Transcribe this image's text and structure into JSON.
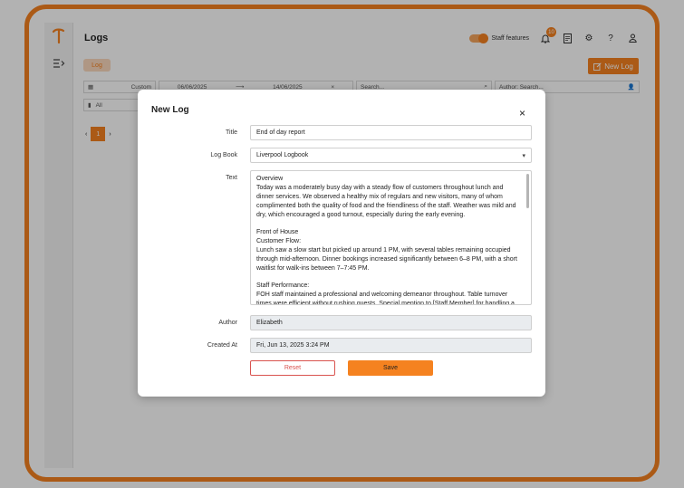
{
  "app": {
    "page_title": "Logs",
    "staff_features_label": "Staff features",
    "notification_count": "10",
    "log_tab_label": "Log",
    "new_log_label": "New Log",
    "accent_color": "#f58220"
  },
  "filters": {
    "range_preset": "Custom",
    "date_from": "06/06/2025",
    "date_to": "14/06/2025",
    "date_arrow": "⟶",
    "clear": "×",
    "search_placeholder": "Search...",
    "author_label": "Author:",
    "author_placeholder": "Search...",
    "logbook_filter": "All"
  },
  "pagination": {
    "prev": "‹",
    "current": "1",
    "next": "›"
  },
  "modal": {
    "title": "New Log",
    "close": "×",
    "fields": {
      "title_label": "Title",
      "title_value": "End of day report",
      "logbook_label": "Log Book",
      "logbook_value": "Liverpool Logbook",
      "text_label": "Text",
      "text_lines": [
        "Overview",
        "Today was a moderately busy day with a steady flow of customers throughout lunch and dinner services. We observed a healthy mix of regulars and new visitors, many of whom complimented both the quality of food and the friendliness of the staff. Weather was mild and dry, which encouraged a good turnout, especially during the early evening.",
        "",
        "Front of House",
        "Customer Flow:",
        "Lunch saw a slow start but picked up around 1 PM, with several tables remaining occupied through mid-afternoon. Dinner bookings increased significantly between 6–8 PM, with a short waitlist for walk-ins between 7–7:45 PM.",
        "",
        "Staff Performance:",
        "FOH staff maintained a professional and welcoming demeanor throughout. Table turnover times were efficient without rushing guests. Special mention to [Staff Member] for handling a"
      ],
      "author_label": "Author",
      "author_value": "Elizabeth",
      "created_label": "Created At",
      "created_value": "Fri, Jun 13, 2025 3:24 PM"
    },
    "reset_label": "Reset",
    "save_label": "Save"
  }
}
